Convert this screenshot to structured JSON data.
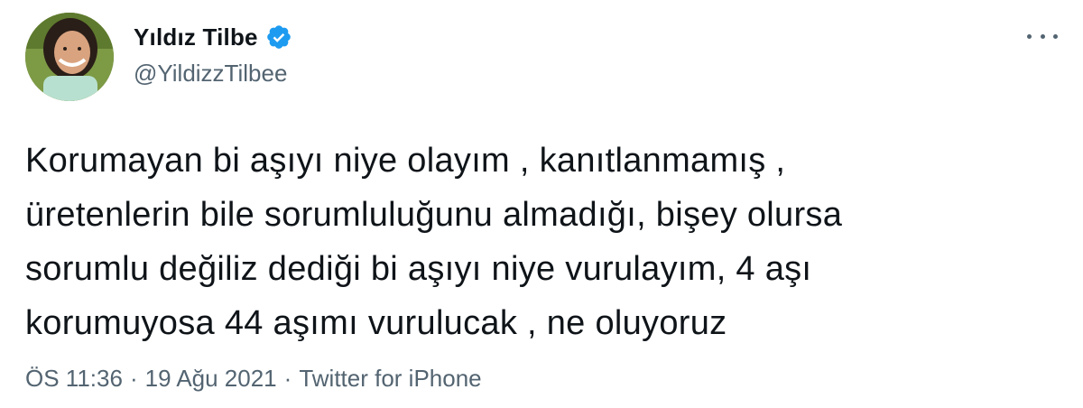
{
  "author": {
    "display_name": "Yıldız Tilbe",
    "handle": "@YildizzTilbee",
    "verified": true
  },
  "tweet": {
    "text": "Korumayan bi aşıyı niye olayım , kanıtlanmamış ,\nüretenlerin bile sorumluluğunu almadığı, bişey olursa\nsorumlu değiliz dediği bi aşıyı niye vurulayım, 4 aşı\nkorumuyosa 44 aşımı vurulucak , ne oluyoruz"
  },
  "meta": {
    "time": "ÖS 11:36",
    "separator": "·",
    "date": "19 Ağu 2021",
    "source": "Twitter for iPhone"
  },
  "icons": {
    "verified": "verified-badge-icon",
    "more": "more-horizontal-icon"
  },
  "colors": {
    "verified_blue": "#1d9bf0",
    "secondary_text": "#536471",
    "primary_text": "#0f1419"
  }
}
